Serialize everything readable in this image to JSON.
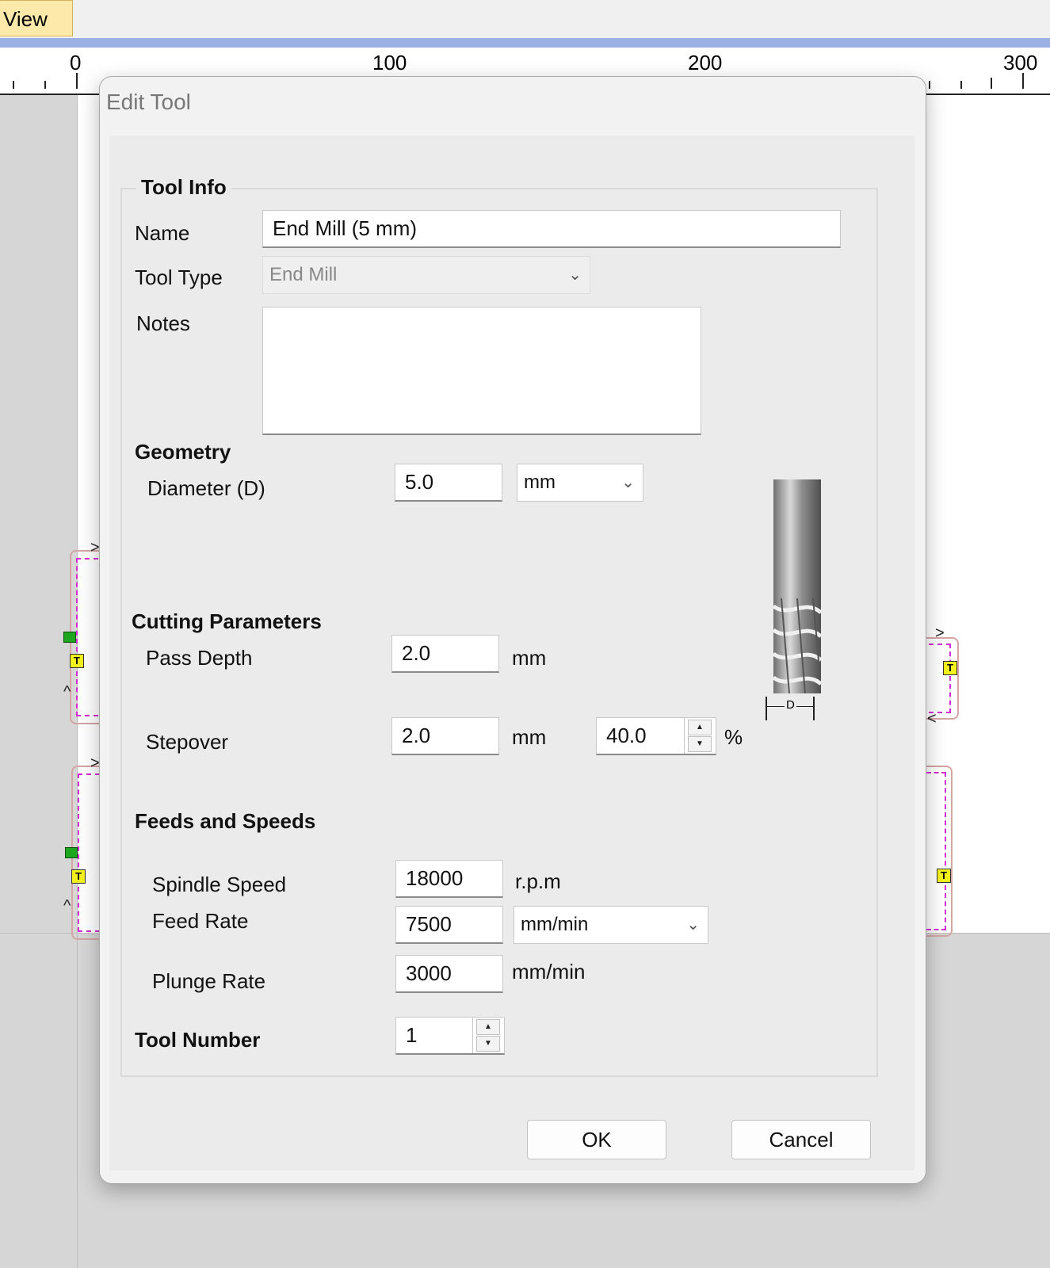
{
  "app": {
    "menu_tab": "View",
    "ruler": {
      "labels": [
        "0",
        "100",
        "200",
        "300"
      ]
    },
    "toolpath_marker": "T"
  },
  "dialog": {
    "title": "Edit Tool",
    "tool_info": {
      "header": "Tool Info",
      "name_label": "Name",
      "name_value": "End Mill (5 mm)",
      "tool_type_label": "Tool Type",
      "tool_type_value": "End Mill",
      "notes_label": "Notes",
      "notes_value": ""
    },
    "geometry": {
      "header": "Geometry",
      "diameter_label": "Diameter (D)",
      "diameter_value": "5.0",
      "diameter_unit": "mm",
      "diagram_label": "D"
    },
    "cutting": {
      "header": "Cutting Parameters",
      "pass_depth_label": "Pass Depth",
      "pass_depth_value": "2.0",
      "pass_depth_unit": "mm",
      "stepover_label": "Stepover",
      "stepover_value": "2.0",
      "stepover_unit": "mm",
      "stepover_percent_value": "40.0",
      "percent_symbol": "%"
    },
    "feeds": {
      "header": "Feeds and Speeds",
      "spindle_label": "Spindle Speed",
      "spindle_value": "18000",
      "spindle_unit": "r.p.m",
      "feed_label": "Feed Rate",
      "feed_value": "7500",
      "feed_unit": "mm/min",
      "plunge_label": "Plunge Rate",
      "plunge_value": "3000",
      "plunge_unit": "mm/min"
    },
    "tool_number": {
      "label": "Tool Number",
      "value": "1"
    },
    "buttons": {
      "ok": "OK",
      "cancel": "Cancel"
    }
  },
  "colors": {
    "toolpath_outline": "#d5a4a4",
    "toolpath_dashed": "#d32bd3",
    "start_marker": "#1fa61f",
    "tab_marker": "#f4f21c"
  }
}
